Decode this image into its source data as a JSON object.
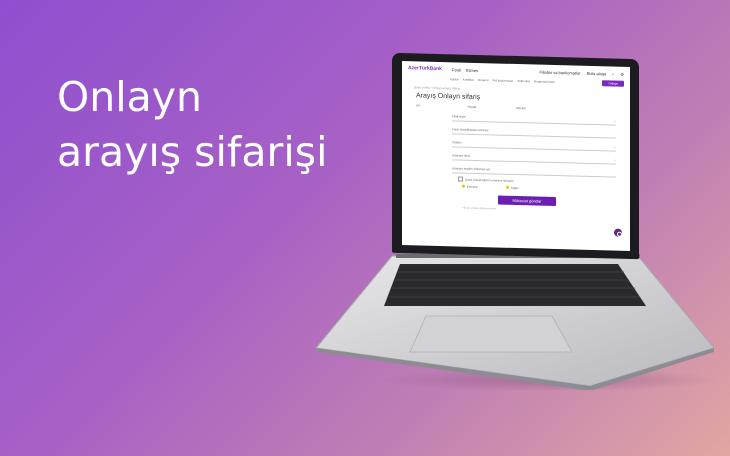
{
  "headline": {
    "line1": "Onlayn",
    "line2": "arayış sifarişi"
  },
  "screen": {
    "logo": "AzerTürkBank",
    "nav_tabs": [
      "Fərdi",
      "Biznes"
    ],
    "top_links": [
      "Filiallar və bankomatlar",
      "Bizlə əlaqə"
    ],
    "subnav": [
      "Kartlar",
      "Kreditlər",
      "Əmanət",
      "Pul köçürmələri",
      "Xidmətlər",
      "Rəqəmsal bank"
    ],
    "cta": "Onlayn",
    "breadcrumb": "Əsas səhifə / Onlayn arayış sifarişi",
    "title": "Arayış Onlayn sifariş",
    "columns": [
      "Ad",
      "Soyad",
      "Ata adı"
    ],
    "fields": [
      "Filial seçin",
      "Fərdi identifikasiya nömrəsi",
      "Telefon",
      "Arayışın növü",
      "Arayışın təqdim ediləcəyi yer"
    ],
    "consent": "Şəxsi məlumatların emalına razıyam",
    "radio_options": [
      "Elektron",
      "Kağız"
    ],
    "submit": "Müraciət göndər",
    "footnote": "* Bütün sahələr doldurulmalıdır"
  }
}
